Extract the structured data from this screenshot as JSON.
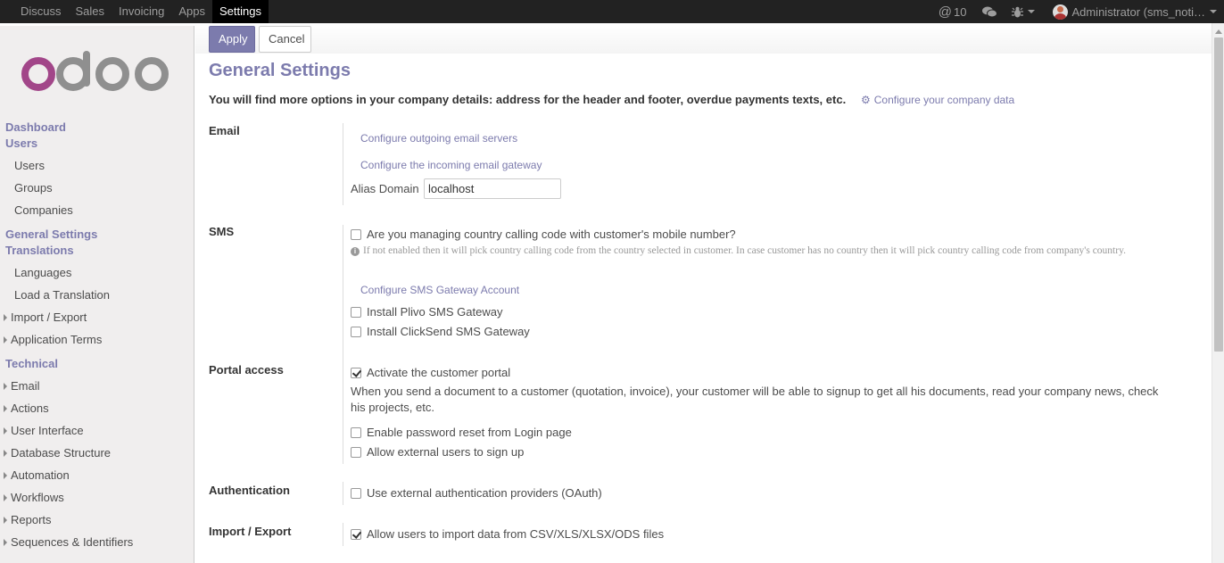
{
  "topbar": {
    "menu": [
      "Discuss",
      "Sales",
      "Invoicing",
      "Apps",
      "Settings"
    ],
    "active": "Settings",
    "mentions_count": "10",
    "user_label": "Administrator (sms_noti…"
  },
  "sidebar": {
    "logo_text": "odoo",
    "groups": [
      {
        "type": "h",
        "label": "Dashboard"
      },
      {
        "type": "h",
        "label": "Users"
      },
      {
        "type": "sub",
        "label": "Users"
      },
      {
        "type": "sub",
        "label": "Groups"
      },
      {
        "type": "sub",
        "label": "Companies"
      },
      {
        "type": "h",
        "label": "General Settings"
      },
      {
        "type": "h",
        "label": "Translations"
      },
      {
        "type": "sub",
        "label": "Languages"
      },
      {
        "type": "sub",
        "label": "Load a Translation"
      },
      {
        "type": "tree",
        "label": "Import / Export"
      },
      {
        "type": "tree",
        "label": "Application Terms"
      },
      {
        "type": "h",
        "label": "Technical"
      },
      {
        "type": "tree",
        "label": "Email"
      },
      {
        "type": "tree",
        "label": "Actions"
      },
      {
        "type": "tree",
        "label": "User Interface"
      },
      {
        "type": "tree",
        "label": "Database Structure"
      },
      {
        "type": "tree",
        "label": "Automation"
      },
      {
        "type": "tree",
        "label": "Workflows"
      },
      {
        "type": "tree",
        "label": "Reports"
      },
      {
        "type": "tree",
        "label": "Sequences & Identifiers"
      }
    ]
  },
  "controls": {
    "apply": "Apply",
    "cancel": "Cancel"
  },
  "page": {
    "title": "General Settings",
    "intro": "You will find more options in your company details: address for the header and footer, overdue payments texts, etc.",
    "company_link": "Configure your company data"
  },
  "email": {
    "label": "Email",
    "outgoing_link": "Configure outgoing email servers",
    "incoming_link": "Configure the incoming email gateway",
    "alias_label": "Alias Domain",
    "alias_value": "localhost"
  },
  "sms": {
    "label": "SMS",
    "country_code_option": "Are you managing country calling code with customer's mobile number?",
    "help": "If not enabled then it will pick country calling code from the country selected in customer. In case customer has no country then it will pick country calling code from company's country.",
    "gateway_link": "Configure SMS Gateway Account",
    "plivo_option": "Install Plivo SMS Gateway",
    "clicksend_option": "Install ClickSend SMS Gateway"
  },
  "portal": {
    "label": "Portal access",
    "activate_option": "Activate the customer portal",
    "description": "When you send a document to a customer (quotation, invoice), your customer will be able to signup to get all his documents, read your company news, check his projects, etc.",
    "password_reset_option": "Enable password reset from Login page",
    "signup_option": "Allow external users to sign up"
  },
  "auth": {
    "label": "Authentication",
    "oauth_option": "Use external authentication providers (OAuth)"
  },
  "import_export": {
    "label": "Import / Export",
    "import_option": "Allow users to import data from CSV/XLS/XLSX/ODS files"
  },
  "checkbox_states": {
    "country_code": false,
    "plivo": false,
    "clicksend": false,
    "portal": true,
    "password_reset": false,
    "signup": false,
    "oauth": false,
    "import": true
  },
  "colors": {
    "accent": "#7c7bad",
    "topbar": "#222222",
    "logo_o": "#a24689",
    "logo_doo": "#8f8f8f"
  }
}
